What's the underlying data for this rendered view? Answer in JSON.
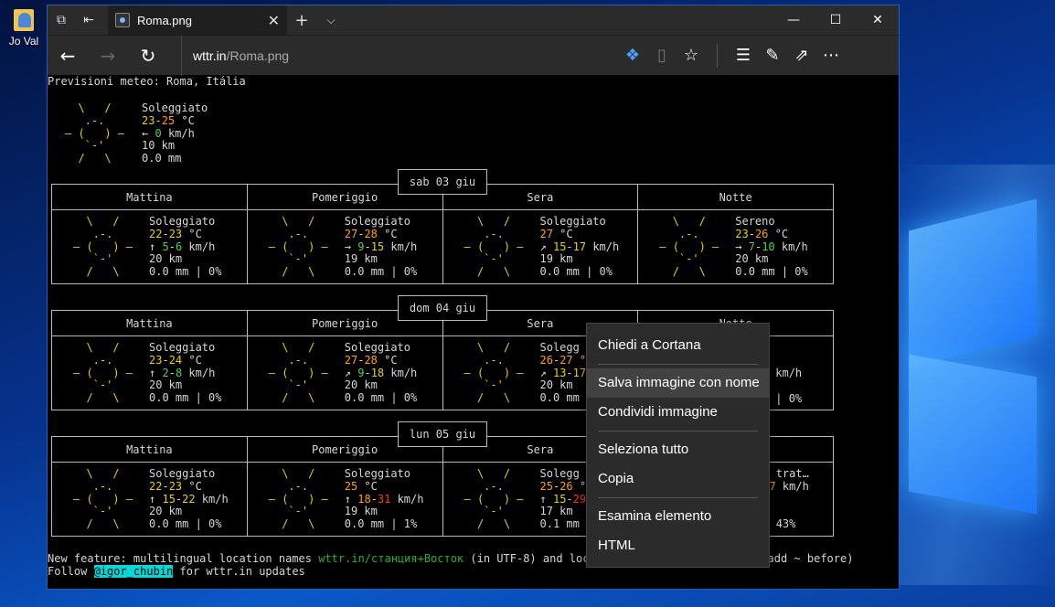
{
  "desktop": {
    "icon_label": "Jo Val"
  },
  "browser": {
    "tab_title": "Roma.png",
    "address_host": "wttr.in",
    "address_path": "/Roma.png"
  },
  "weather": {
    "header": "Previsioni meteo: Roma, Itália",
    "now": {
      "condition": "Soleggiato",
      "temp_a": "23",
      "temp_b": "25",
      "temp_unit": "°C",
      "wind_arrow": "←",
      "wind": "0",
      "wind_unit": "km/h",
      "visibility": "10 km",
      "precip": "0.0 mm"
    },
    "period_labels": [
      "Mattina",
      "Pomeriggio",
      "Sera",
      "Notte"
    ],
    "days": [
      {
        "date": "sab 03 giu",
        "periods": [
          {
            "cond": "Soleggiato",
            "t1": "22",
            "t2": "23",
            "arrow": "↑",
            "w1": "5",
            "w2": "6",
            "vis": "20 km",
            "rain": "0.0 mm | 0%"
          },
          {
            "cond": "Soleggiato",
            "t1": "27",
            "t2": "28",
            "arrow": "→",
            "w1": "9",
            "w2": "15",
            "vis": "19 km",
            "rain": "0.0 mm | 0%"
          },
          {
            "cond": "Soleggiato",
            "t1": "27",
            "t2": "",
            "arrow": "↗",
            "w1": "15",
            "w2": "17",
            "vis": "19 km",
            "rain": "0.0 mm | 0%"
          },
          {
            "cond": "Sereno",
            "t1": "23",
            "t2": "26",
            "arrow": "→",
            "w1": "7",
            "w2": "10",
            "vis": "20 km",
            "rain": "0.0 mm | 0%"
          }
        ]
      },
      {
        "date": "dom 04 giu",
        "periods": [
          {
            "cond": "Soleggiato",
            "t1": "23",
            "t2": "24",
            "arrow": "↑",
            "w1": "2",
            "w2": "8",
            "vis": "20 km",
            "rain": "0.0 mm | 0%"
          },
          {
            "cond": "Soleggiato",
            "t1": "27",
            "t2": "28",
            "arrow": "↗",
            "w1": "9",
            "w2": "18",
            "vis": "20 km",
            "rain": "0.0 mm | 0%"
          },
          {
            "cond": "Solegg",
            "t1": "26",
            "t2": "27",
            "arrow": "↗",
            "w1": "13",
            "w2": "17",
            "vis": "20 km",
            "rain": "0.0 mm"
          },
          {
            "cond": "",
            "t1": "",
            "t2": "",
            "arrow": "",
            "w1": "",
            "w2": "",
            "vis": "",
            "rain": "| 0%"
          }
        ]
      },
      {
        "date": "lun 05 giu",
        "periods": [
          {
            "cond": "Soleggiato",
            "t1": "22",
            "t2": "23",
            "arrow": "↑",
            "w1": "15",
            "w2": "22",
            "vis": "20 km",
            "rain": "0.0 mm | 0%"
          },
          {
            "cond": "Soleggiato",
            "t1": "25",
            "t2": "",
            "arrow": "↑",
            "w1": "18",
            "w2": "31",
            "vis": "19 km",
            "rain": "0.0 mm | 1%"
          },
          {
            "cond": "Solegg",
            "t1": "25",
            "t2": "26",
            "arrow": "↑",
            "w1": "15",
            "w2": "29",
            "vis": "17 km",
            "rain": "0.1 mm"
          },
          {
            "cond": "a trat…",
            "t1": "",
            "t2": "",
            "arrow": "",
            "w1": "",
            "w2": "27",
            "vis": "",
            "rain": "| 43%"
          }
        ]
      }
    ],
    "footer_1a": "New feature: multilingual location names ",
    "footer_1b": "wttr.in/станция+Восток",
    "footer_1c": " (in UTF-8) and locatio",
    "footer_1d": "(just add ~ before)",
    "footer_2a": "Follow ",
    "footer_2b": "@igor_chubin",
    "footer_2c": " for wttr.in updates"
  },
  "context_menu": {
    "items": [
      "Chiedi a Cortana",
      "Salva immagine con nome",
      "Condividi immagine",
      "Seleziona tutto",
      "Copia",
      "Esamina elemento",
      "HTML"
    ]
  }
}
